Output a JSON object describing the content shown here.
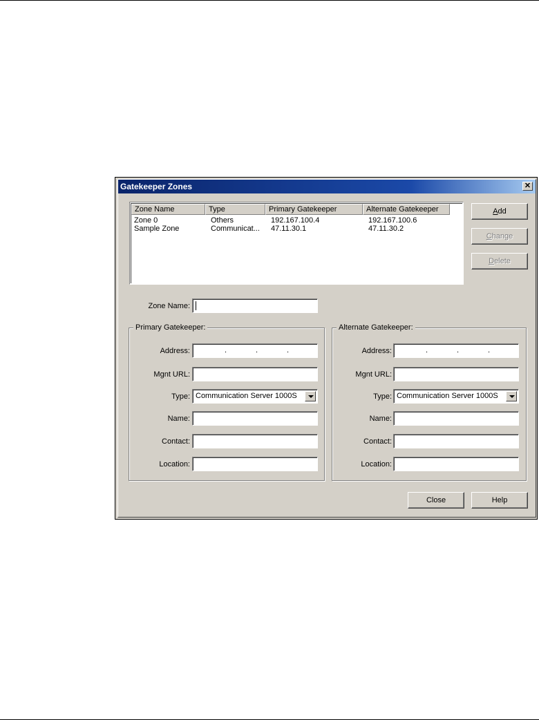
{
  "dialog": {
    "title": "Gatekeeper Zones",
    "close_glyph": "✕"
  },
  "zone_list": {
    "columns": [
      "Zone Name",
      "Type",
      "Primary Gatekeeper",
      "Alternate Gatekeeper"
    ],
    "rows": [
      [
        "Zone 0",
        "Others",
        "192.167.100.4",
        "192.167.100.6"
      ],
      [
        "Sample Zone",
        "Communicat...",
        "47.11.30.1",
        "47.11.30.2"
      ]
    ]
  },
  "buttons": {
    "add": {
      "label_prefix": "",
      "underline": "A",
      "label_suffix": "dd"
    },
    "change": {
      "label_prefix": "",
      "underline": "C",
      "label_suffix": "hange"
    },
    "delete": {
      "label_prefix": "",
      "underline": "D",
      "label_suffix": "elete"
    },
    "close": "Close",
    "help": "Help"
  },
  "zone_name": {
    "label": "Zone Name:",
    "value": ""
  },
  "primary": {
    "legend": "Primary Gatekeeper:",
    "address_label": "Address:",
    "mgnt_url_label": "Mgnt URL:",
    "type_label": "Type:",
    "type_value": "Communication Server 1000S",
    "name_label": "Name:",
    "contact_label": "Contact:",
    "location_label": "Location:"
  },
  "alternate": {
    "legend": "Alternate Gatekeeper:",
    "address_label": "Address:",
    "mgnt_url_label": "Mgnt URL:",
    "type_label": "Type:",
    "type_value": "Communication Server 1000S",
    "name_label": "Name:",
    "contact_label": "Contact:",
    "location_label": "Location:"
  },
  "ip_separator": ".",
  "colors": {
    "title_bar": "#0a246a",
    "dialog_face": "#d4d0c8",
    "disabled_text": "#808080"
  },
  "icons": {
    "close": "close-icon",
    "dropdown": "chevron-down-icon"
  }
}
